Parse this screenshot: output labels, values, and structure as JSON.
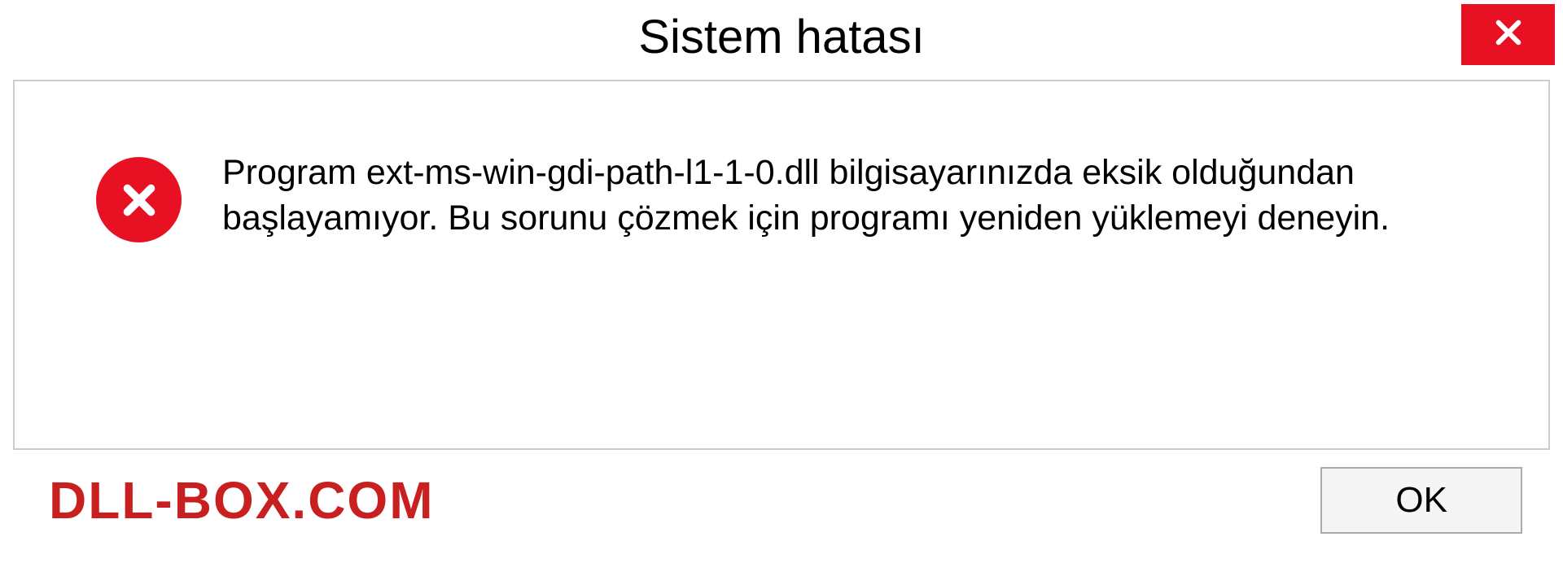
{
  "dialog": {
    "title": "Sistem hatası",
    "message": "Program ext-ms-win-gdi-path-l1-1-0.dll bilgisayarınızda eksik olduğundan başlayamıyor. Bu sorunu çözmek için programı yeniden yüklemeyi deneyin.",
    "ok_label": "OK"
  },
  "watermark": "DLL-BOX.COM"
}
